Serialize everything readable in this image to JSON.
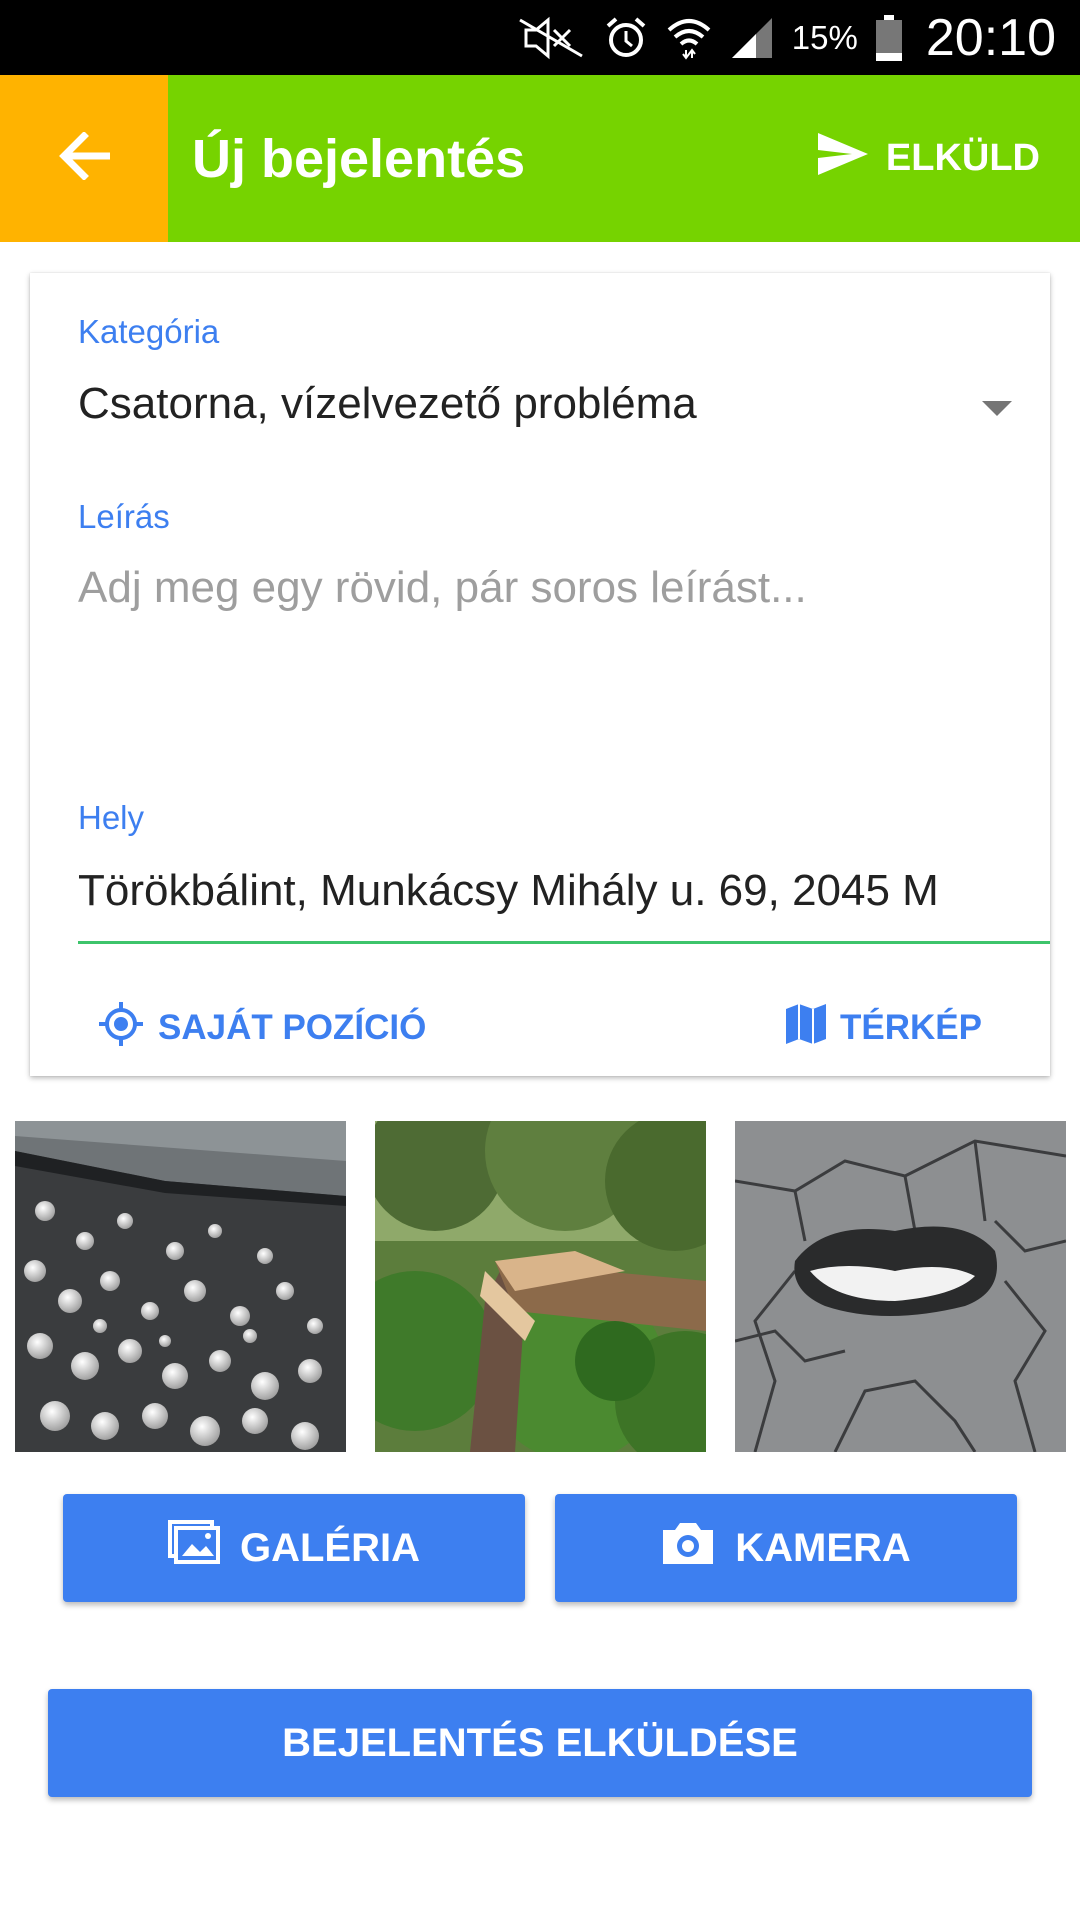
{
  "status_bar": {
    "battery_percent": "15%",
    "time": "20:10"
  },
  "app_bar": {
    "title": "Új bejelentés",
    "send_label": "ELKÜLD",
    "colors": {
      "back_area": "#ffb300",
      "main_area": "#76d300"
    }
  },
  "form": {
    "category": {
      "label": "Kategória",
      "value": "Csatorna, vízelvezető probléma"
    },
    "description": {
      "label": "Leírás",
      "placeholder": "Adj meg egy rövid, pár soros leírást..."
    },
    "location": {
      "label": "Hely",
      "value": "Törökbálint, Munkácsy Mihály u. 69, 2045 M"
    },
    "actions": {
      "own_position": "SAJÁT POZÍCIÓ",
      "map": "TÉRKÉP"
    }
  },
  "photos": [
    {
      "subject": "hailstones"
    },
    {
      "subject": "fallen-tree"
    },
    {
      "subject": "pothole"
    }
  ],
  "buttons": {
    "gallery": "GALÉRIA",
    "camera": "KAMERA",
    "submit": "BEJELENTÉS ELKÜLDÉSE"
  },
  "accent_color": "#3d7ff0"
}
